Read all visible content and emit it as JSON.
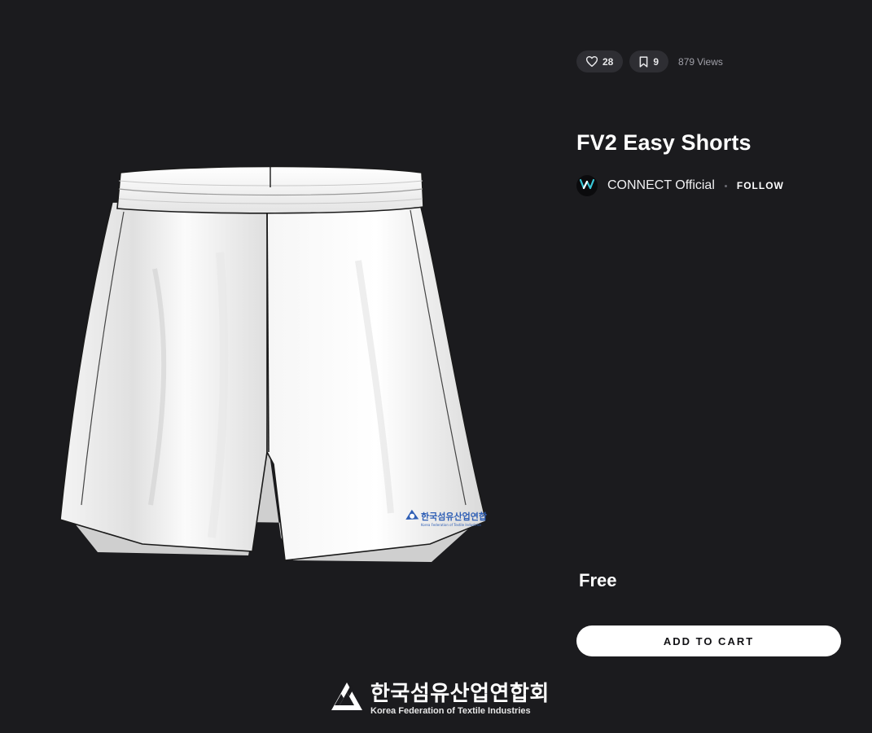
{
  "stats": {
    "likes": "28",
    "saves": "9",
    "views_count": "879",
    "views_label": "Views"
  },
  "product": {
    "title": "FV2 Easy Shorts",
    "price": "Free",
    "image_alt": "FV2 Easy Shorts 3D render",
    "print_logo_ko": "한국섬유산업연합",
    "print_logo_en": "Korea Federation of Textile Industries"
  },
  "creator": {
    "name": "CONNECT Official",
    "follow_label": "FOLLOW"
  },
  "actions": {
    "add_to_cart_label": "ADD TO CART"
  },
  "brand": {
    "name_ko": "한국섬유산업연합회",
    "name_en": "Korea Federation of Textile Industries"
  },
  "icons": {
    "like": "heart-icon",
    "save": "bookmark-icon",
    "avatar": "connect-logo-icon",
    "brand": "kofoti-logo-icon"
  },
  "colors": {
    "background": "#1b1b1e",
    "pill": "#2e2e33",
    "button": "#ffffff",
    "logo_blue": "#2f5fb5"
  }
}
